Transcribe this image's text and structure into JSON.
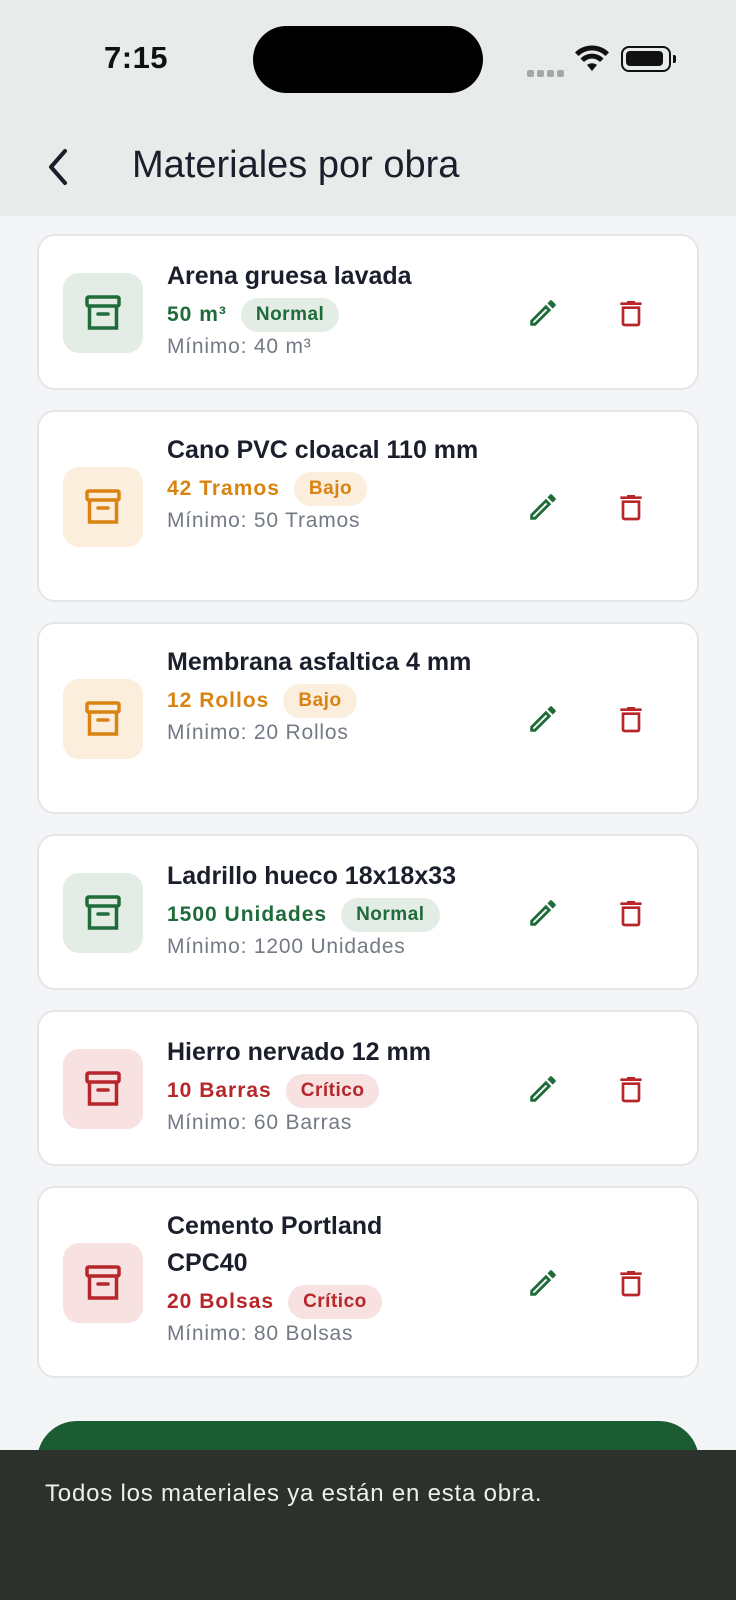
{
  "status": {
    "time": "7:15"
  },
  "header": {
    "title": "Materiales por obra"
  },
  "materials": [
    {
      "name": "Arena gruesa lavada",
      "qty": "50 m³",
      "badge": "Normal",
      "min": "Mínimo: 40 m³",
      "level": "normal",
      "color": "#1f6b3a"
    },
    {
      "name": "Cano PVC cloacal 110 mm",
      "qty": "42 Tramos",
      "badge": "Bajo",
      "min": "Mínimo: 50 Tramos",
      "level": "bajo",
      "color": "#d98312"
    },
    {
      "name": "Membrana asfaltica 4 mm",
      "qty": "12 Rollos",
      "badge": "Bajo",
      "min": "Mínimo: 20 Rollos",
      "level": "bajo",
      "color": "#d98312"
    },
    {
      "name": "Ladrillo hueco 18x18x33",
      "qty": "1500 Unidades",
      "badge": "Normal",
      "min": "Mínimo: 1200 Unidades",
      "level": "normal",
      "color": "#1f6b3a"
    },
    {
      "name": "Hierro nervado 12 mm",
      "qty": "10 Barras",
      "badge": "Crítico",
      "min": "Mínimo: 60 Barras",
      "level": "critico",
      "color": "#b7262b"
    },
    {
      "name": "Cemento Portland CPC40",
      "qty": "20 Bolsas",
      "badge": "Crítico",
      "min": "Mínimo: 80 Bolsas",
      "level": "critico",
      "color": "#b7262b"
    }
  ],
  "icons": {
    "item": "archive-box-icon",
    "edit": "pencil-icon",
    "delete": "trash-icon",
    "back": "chevron-left-icon"
  },
  "colors": {
    "edit": "#1f6b3a",
    "delete": "#b7262b",
    "primary_button": "#1c5c33",
    "snackbar": "#2c312c"
  },
  "snackbar": {
    "message": "Todos los materiales ya están en esta obra."
  }
}
